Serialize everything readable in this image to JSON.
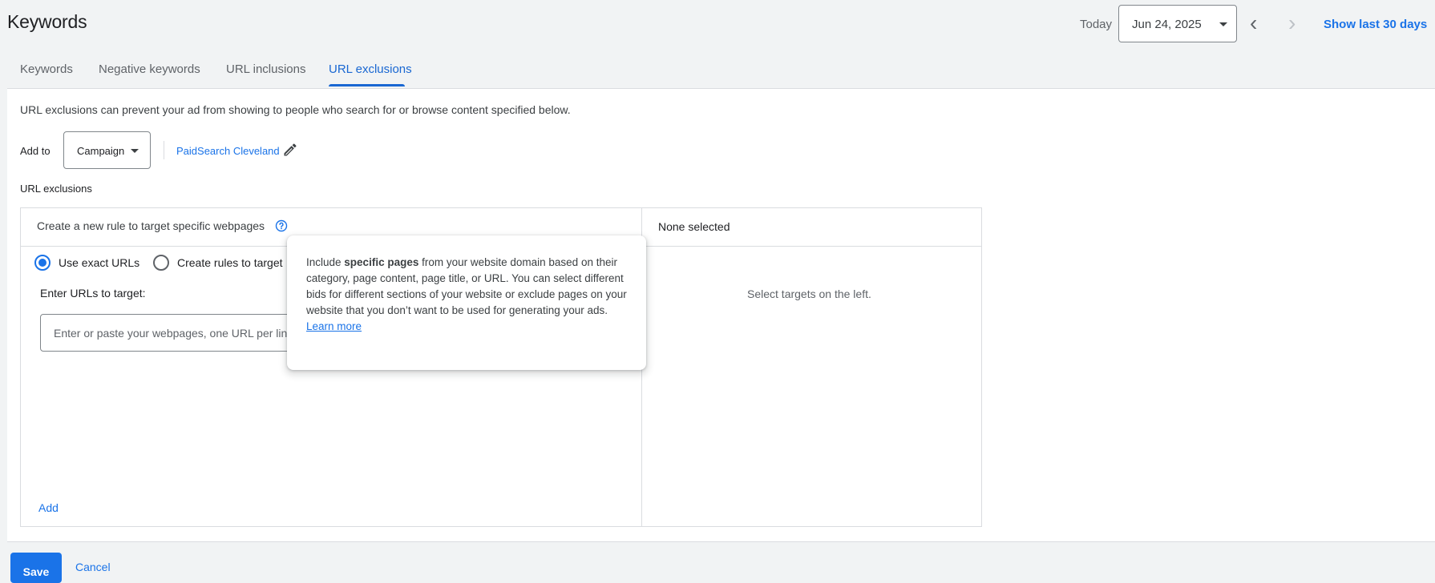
{
  "header": {
    "title": "Keywords",
    "today_label": "Today",
    "date_value": "Jun 24, 2025",
    "show_last_label": "Show last 30 days"
  },
  "tabs": [
    {
      "label": "Keywords",
      "active": false
    },
    {
      "label": "Negative keywords",
      "active": false
    },
    {
      "label": "URL inclusions",
      "active": false
    },
    {
      "label": "URL exclusions",
      "active": true
    }
  ],
  "main": {
    "description": "URL exclusions can prevent your ad from showing to people who search for or browse content specified below.",
    "add_to_label": "Add to",
    "campaign_select_value": "Campaign",
    "campaign_name": "PaidSearch Cleveland",
    "section_label": "URL exclusions",
    "rule_title": "Create a new rule to target specific webpages",
    "none_selected": "None selected",
    "select_targets": "Select targets on the left.",
    "radio_exact_label": "Use exact URLs",
    "radio_rules_label": "Create rules to target",
    "enter_urls_label": "Enter URLs to target:",
    "url_input_placeholder": "Enter or paste your webpages, one URL per line",
    "add_label": "Add"
  },
  "tooltip": {
    "text_before": "Include ",
    "text_bold": "specific pages",
    "text_after": " from your website domain based on their category, page content, page title, or URL. You can select different bids for different sections of your website or exclude pages on your website that you don’t want to be used for generating your ads.",
    "learn_more": "Learn more"
  },
  "footer": {
    "save_label": "Save",
    "cancel_label": "Cancel"
  },
  "colors": {
    "accent": "#1a73e8",
    "active_tab": "#1967d2"
  }
}
